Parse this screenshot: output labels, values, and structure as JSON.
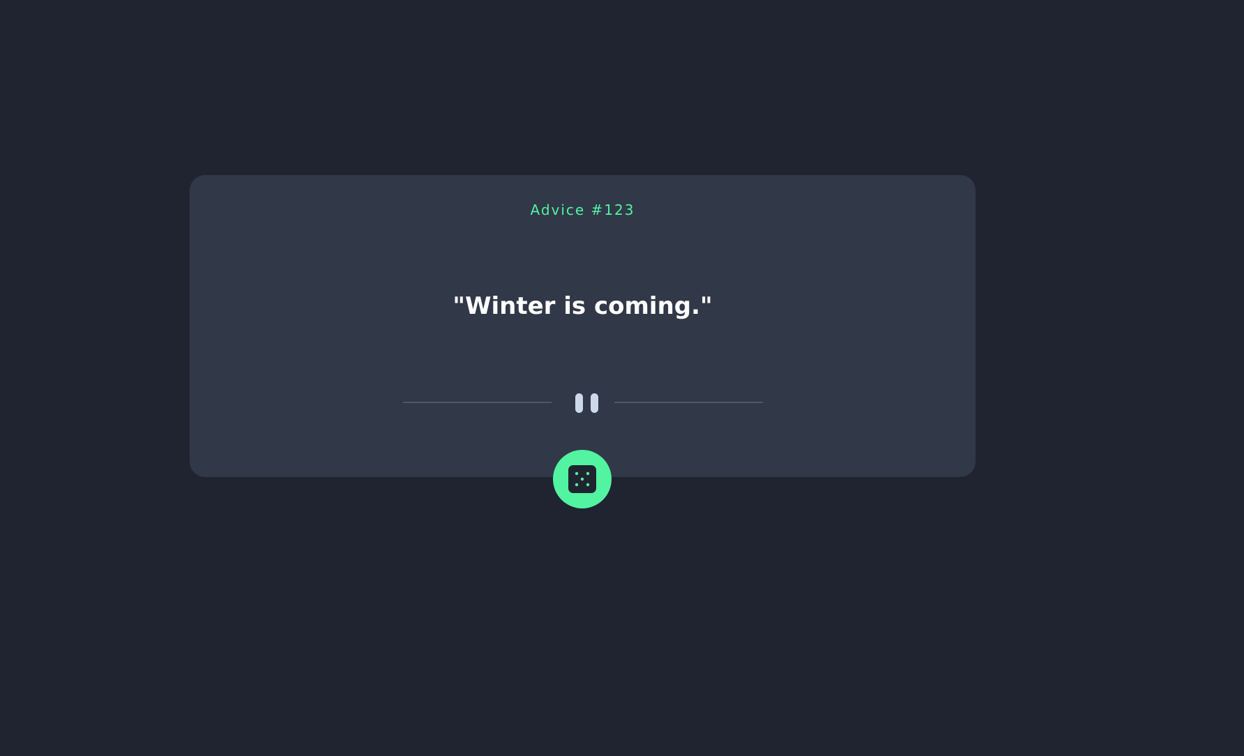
{
  "card": {
    "advice_label": "Advice #123",
    "quote": "\"Winter is coming.\""
  },
  "divider": {
    "icon": "pause-icon"
  },
  "dice_button": {
    "icon": "dice-icon"
  },
  "colors": {
    "background": "#1f2430",
    "card": "#313848",
    "accent": "#52f4a1",
    "quote_text": "#ffffff",
    "divider_line": "#4e5968",
    "pause_bars": "#cdd9e8"
  }
}
